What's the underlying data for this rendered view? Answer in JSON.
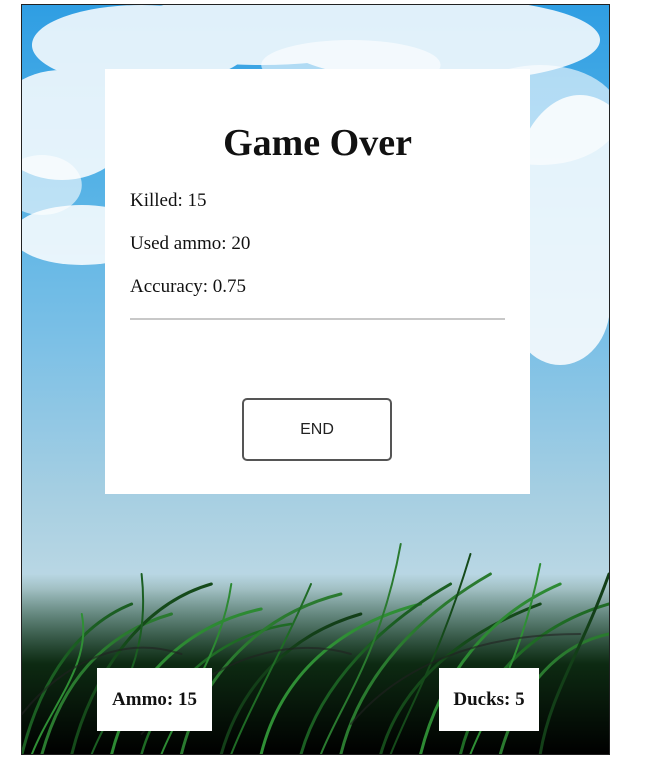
{
  "dialog": {
    "title": "Game Over",
    "stats": {
      "killed": "Killed: 15",
      "used_ammo": "Used ammo: 20",
      "accuracy": "Accuracy: 0.75"
    },
    "end_button_label": "END"
  },
  "hud": {
    "ammo_label": "Ammo: 15",
    "ducks_label": "Ducks: 5"
  },
  "colors": {
    "sky_top": "#2f9ee3",
    "sky_bottom": "#bcd8e4",
    "grass_dark": "#0c1a10",
    "grass_green": "#1e7a25"
  }
}
